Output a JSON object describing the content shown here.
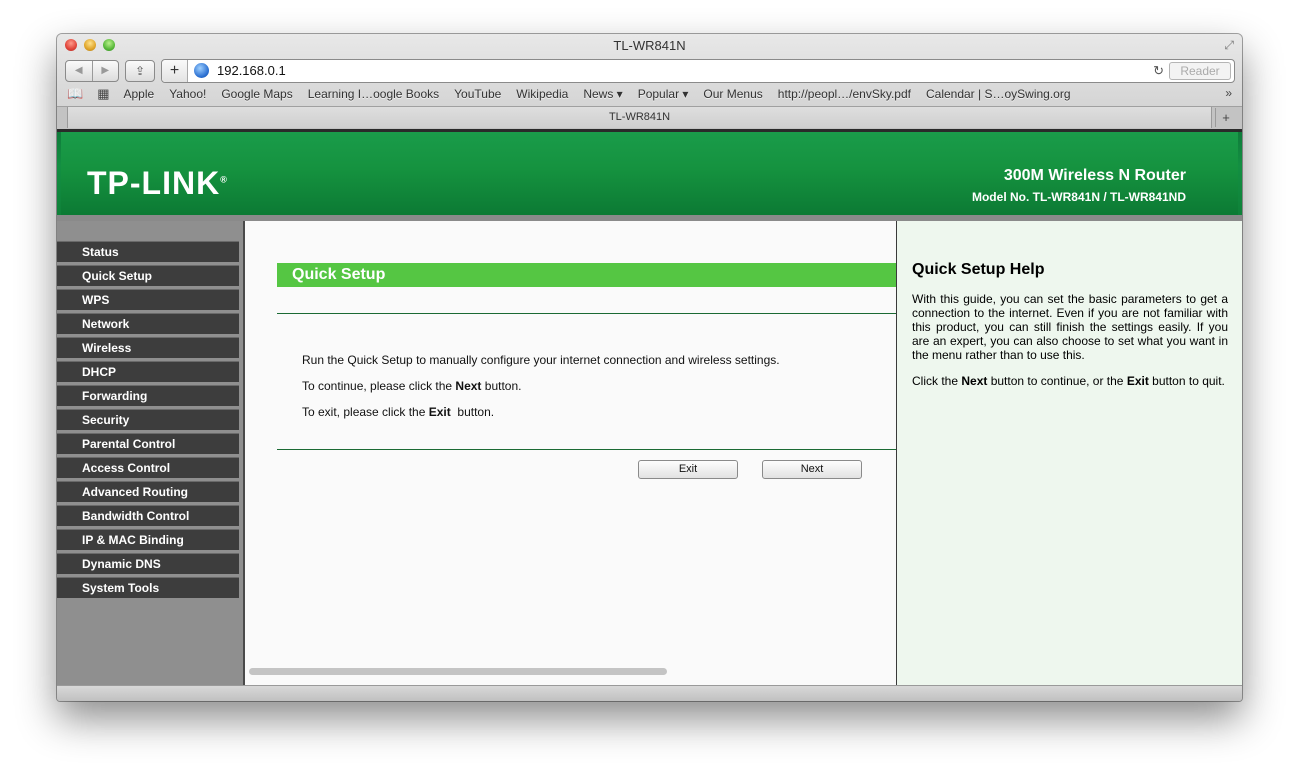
{
  "window": {
    "title": "TL-WR841N"
  },
  "toolbar": {
    "url": "192.168.0.1",
    "reader_label": "Reader"
  },
  "bookmarks": [
    "Apple",
    "Yahoo!",
    "Google Maps",
    "Learning I…oogle Books",
    "YouTube",
    "Wikipedia",
    "News ▾",
    "Popular ▾",
    "Our Menus",
    "http://peopl…/envSky.pdf",
    "Calendar | S…oySwing.org"
  ],
  "tab": {
    "title": "TL-WR841N"
  },
  "banner": {
    "logo": "TP-LINK",
    "product": "300M Wireless N Router",
    "model": "Model No. TL-WR841N / TL-WR841ND"
  },
  "menu": [
    "Status",
    "Quick Setup",
    "WPS",
    "Network",
    "Wireless",
    "DHCP",
    "Forwarding",
    "Security",
    "Parental Control",
    "Access Control",
    "Advanced Routing",
    "Bandwidth Control",
    "IP & MAC Binding",
    "Dynamic DNS",
    "System Tools"
  ],
  "main": {
    "title": "Quick Setup",
    "line1": "Run the Quick Setup to manually configure your internet connection and wireless settings.",
    "line2_pre": "To continue, please click the ",
    "line2_bold": "Next",
    "line2_post": " button.",
    "line3_pre": "To exit, please click the ",
    "line3_bold": "Exit",
    "line3_post": "  button.",
    "exit_label": "Exit",
    "next_label": "Next"
  },
  "help": {
    "title": "Quick Setup Help",
    "text": "With this guide, you can set the basic parameters to get a connection to the internet. Even if you are not familiar with this product, you can still finish the settings easily. If you are an expert, you can also choose to set what you want in the menu rather than to use this.",
    "text2_pre": "Click the ",
    "text2_b1": "Next",
    "text2_mid": " button to continue, or the ",
    "text2_b2": "Exit",
    "text2_post": " button to quit."
  },
  "colors": {
    "banner": "#138f42",
    "section_title": "#55c643",
    "menu_bg": "#3d3d3d"
  }
}
